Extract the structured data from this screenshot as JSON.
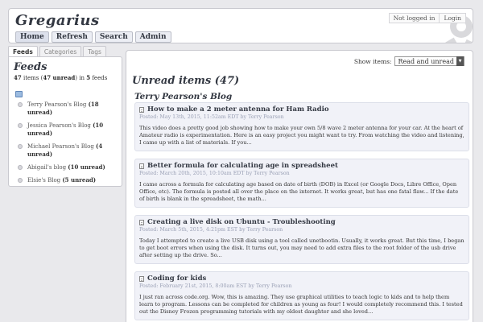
{
  "header": {
    "title": "Gregarius",
    "nav": [
      "Home",
      "Refresh",
      "Search",
      "Admin"
    ],
    "login_status": "Not logged in",
    "login_link": "Login"
  },
  "sidebar": {
    "tabs": [
      "Feeds",
      "Categories",
      "Tags"
    ],
    "title": "Feeds",
    "summary": {
      "items": "47",
      "items_word": " items (",
      "unread": "47 unread",
      "mid": ") in ",
      "feeds": "5",
      "feeds_word": " feeds"
    },
    "feeds": [
      {
        "name": "Terry Pearson's Blog ",
        "count": "(18 unread)"
      },
      {
        "name": "Jessica Pearson's Blog ",
        "count": "(10 unread)"
      },
      {
        "name": "Michael Pearson's Blog ",
        "count": "(4 unread)"
      },
      {
        "name": "Abigail's blog ",
        "count": "(10 unread)"
      },
      {
        "name": "Elsie's Blog ",
        "count": "(5 unread)"
      }
    ]
  },
  "main": {
    "show_items_label": "Show items:",
    "show_items_value": "Read and unread",
    "heading": "Unread items (47)",
    "group_title": "Terry Pearson's Blog",
    "items": [
      {
        "title": "How to make a 2 meter antenna for Ham Radio",
        "meta": "Posted: May 13th, 2015, 11:52am EDT by Terry Pearson",
        "body": "This video does a pretty good job showing how to make your own 5/8 wave 2 meter antenna for your car. At the heart of Amateur radio is experimentation. Here is an easy project you might want to try. From watching the video and listening, I came up with a list of materials. If you..."
      },
      {
        "title": "Better formula for calculating age in spreadsheet",
        "meta": "Posted: March 20th, 2015, 10:10am EDT by Terry Pearson",
        "body": "I came across a formula for calculating age based on date of birth (DOB) in Excel (or Google Docs, Libre Office, Open Office, etc). The formula is posted all over the place on the internet. It works great, but has one fatal flaw... If the date of birth is blank in the spreadsheet, the math..."
      },
      {
        "title": "Creating a live disk on Ubuntu - Troubleshooting",
        "meta": "Posted: March 5th, 2015, 4:21pm EST by Terry Pearson",
        "body": "Today I attempted to create a live USB disk using a tool called unetbootin. Usually, it works great. But this time, I began to get boot errors when using the disk. It turns out, you may need to add extra files to the root folder of the usb drive after setting up the drive. So..."
      },
      {
        "title": "Coding for kids",
        "meta": "Posted: February 21st, 2015, 8:00am EST by Terry Pearson",
        "body": "I just ran across code.org. Wow, this is amazing. They use graphical utilities to teach logic to kids and to help them learn to program. Lessons can be completed for children as young as four! I would completely recommend this. I tested out the Disney Frozen programming tutorials with my oldest daughter and she loved..."
      }
    ]
  }
}
